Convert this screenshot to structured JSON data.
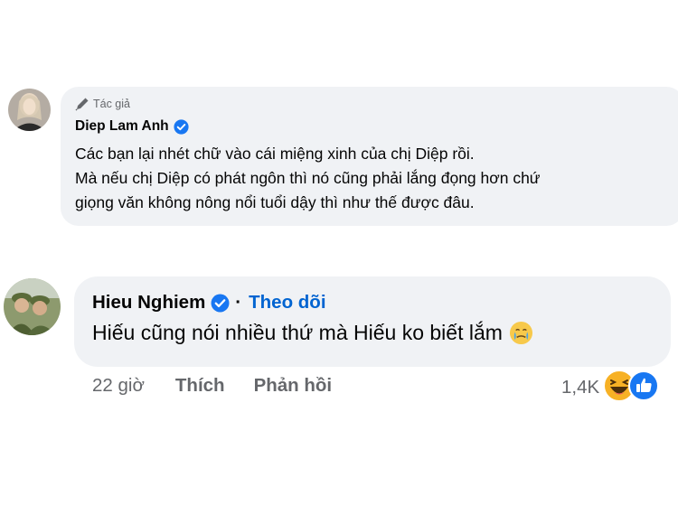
{
  "comment": {
    "author_tag_label": "Tác giả",
    "author_name": "Diep Lam Anh",
    "lines": [
      "Các bạn lại nhét chữ vào cái miệng xinh của chị Diệp rồi.",
      "Mà nếu chị Diệp có phát ngôn thì nó cũng phải lắng đọng hơn chứ",
      "giọng văn không nông nổi tuổi dậy thì như thế được đâu."
    ],
    "icons": {
      "author": "pen-icon",
      "verified": "verified-badge-icon"
    }
  },
  "reply": {
    "author_name": "Hieu Nghiem",
    "separator": "·",
    "follow_label": "Theo dõi",
    "text": "Hiếu cũng nói nhiều thứ mà Hiếu ko biết lắm",
    "time": "22 giờ",
    "like_label": "Thích",
    "reply_label": "Phản hồi",
    "reaction_count": "1,4K",
    "icons": {
      "emoji": "tearful-face-icon",
      "reactions": [
        "haha-reaction-icon",
        "like-reaction-icon"
      ]
    }
  },
  "colors": {
    "bubble": "#f0f2f5",
    "follow": "#0064d1",
    "verified": "#1877f2",
    "secondary_text": "#65676b"
  }
}
